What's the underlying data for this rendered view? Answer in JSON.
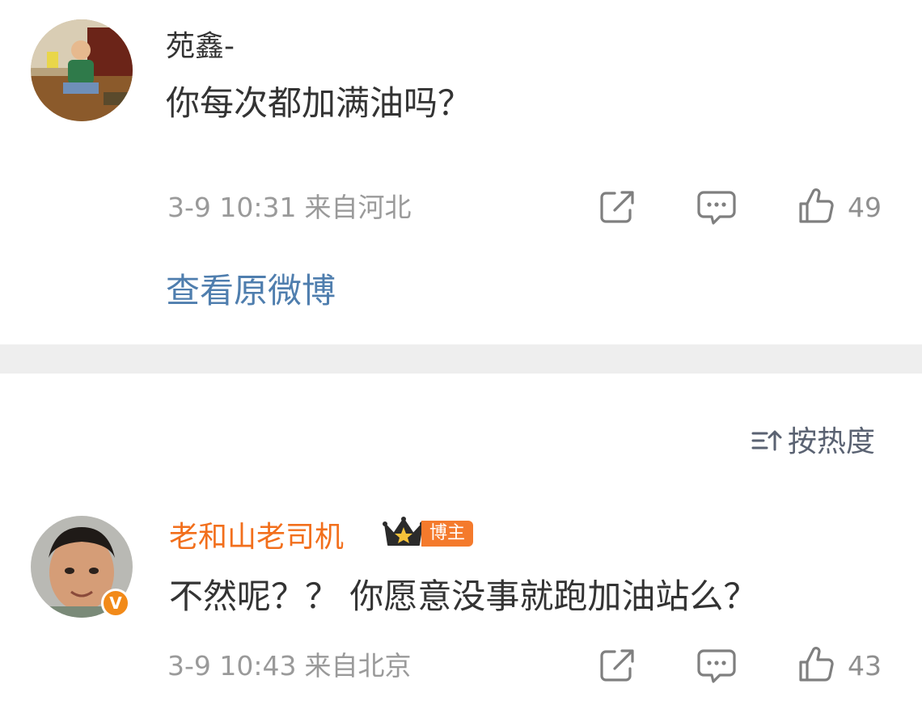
{
  "comments": [
    {
      "username": "苑鑫-",
      "text": "你每次都加满油吗？",
      "date": "3-9 10:31",
      "location": "来自河北",
      "like_count": "49"
    },
    {
      "username": "老和山老司机",
      "badge": "博主",
      "text": "不然呢？？ 你愿意没事就跑加油站么？",
      "date": "3-9 10:43",
      "location": "来自北京",
      "like_count": "43"
    }
  ],
  "view_original_label": "查看原微博",
  "sort": {
    "label": "按热度",
    "icon": "sort-icon"
  },
  "icons": {
    "share": "share-icon",
    "comment": "comment-icon",
    "like": "thumbs-up-icon",
    "crown": "crown-icon",
    "verified": "verified-v-icon"
  },
  "colors": {
    "link": "#4f7eae",
    "vip_name": "#f26f1c",
    "badge_bg": "#f47a2c",
    "meta_text": "#9a9a9a",
    "divider": "#eeeeee"
  }
}
